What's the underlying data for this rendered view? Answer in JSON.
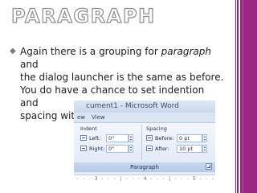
{
  "slide": {
    "title": "PARAGRAPH",
    "bullet_glyph": "◆",
    "bullet": {
      "lines": [
        {
          "before": "Again there is a grouping for ",
          "italic": "paragraph",
          "after": " and"
        },
        {
          "text": "the dialog launcher is the same as before."
        },
        {
          "text": "You do have a chance to set indention and"
        },
        {
          "text": "spacing without the dialog box."
        }
      ]
    }
  },
  "word_screenshot": {
    "window_title": "cument1 - Microsoft Word",
    "menu": [
      "ew",
      "View"
    ],
    "groups": {
      "indent": {
        "label": "Indent",
        "left_label": "Left:",
        "left_value": "0\"",
        "right_label": "Right:",
        "right_value": "0\""
      },
      "spacing": {
        "label": "Spacing",
        "before_label": "Before:",
        "before_value": "0 pt",
        "after_label": "After:",
        "after_value": "10 pt"
      }
    },
    "group_name": "Paragraph",
    "ruler_text": "· · · 3 · · · | · · · 4 · · · | · · · 5 · · · | · · ·"
  },
  "colors": {
    "accent_strip": "#9b2684",
    "title_outline": "#8c8c8c",
    "body_text": "#202020"
  }
}
